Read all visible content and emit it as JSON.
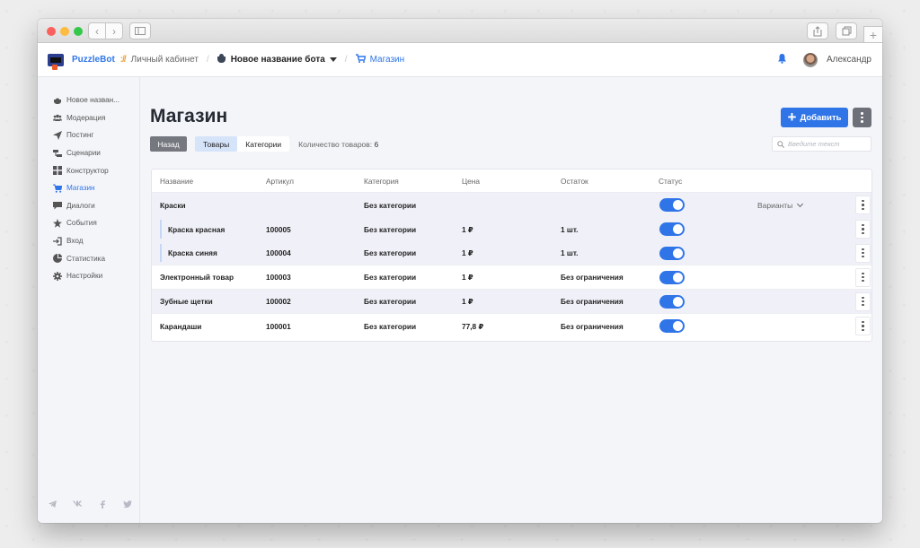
{
  "browser": {
    "icons": [
      "back-icon",
      "forward-icon",
      "sidebar-icon",
      "share-icon",
      "tabs-icon",
      "new-tab-icon"
    ]
  },
  "header": {
    "brand": "PuzzleBot",
    "brand_sep": "://",
    "crumb_cabinet": "Личный кабинет",
    "bot_name": "Новое название бота",
    "crumb_shop": "Магазин",
    "user_name": "Александр",
    "accent": "#2f75e8"
  },
  "sidebar": {
    "items": [
      {
        "label": "Новое назван...",
        "icon": "bot-icon",
        "active": false
      },
      {
        "label": "Модерация",
        "icon": "users-icon",
        "active": false
      },
      {
        "label": "Постинг",
        "icon": "send-icon",
        "active": false
      },
      {
        "label": "Сценарии",
        "icon": "scenario-icon",
        "active": false
      },
      {
        "label": "Конструктор",
        "icon": "grid-icon",
        "active": false
      },
      {
        "label": "Магазин",
        "icon": "cart-icon",
        "active": true
      },
      {
        "label": "Диалоги",
        "icon": "chat-icon",
        "active": false
      },
      {
        "label": "События",
        "icon": "star-icon",
        "active": false
      },
      {
        "label": "Вход",
        "icon": "login-icon",
        "active": false
      },
      {
        "label": "Статистика",
        "icon": "chart-icon",
        "active": false
      },
      {
        "label": "Настройки",
        "icon": "gear-icon",
        "active": false
      }
    ],
    "social": [
      "telegram-icon",
      "vk-icon",
      "facebook-icon",
      "twitter-icon"
    ]
  },
  "main": {
    "title": "Магазин",
    "add_label": "Добавить",
    "back_label": "Назад",
    "tab_products": "Товары",
    "tab_categories": "Категории",
    "count_label": "Количество товаров:",
    "count_value": "6",
    "search_placeholder": "Введите текст"
  },
  "table": {
    "headers": {
      "name": "Название",
      "sku": "Артикул",
      "category": "Категория",
      "price": "Цена",
      "stock": "Остаток",
      "status": "Статус"
    },
    "variants_label": "Варианты",
    "rows": [
      {
        "name": "Краски",
        "sku": "",
        "category": "Без категории",
        "price": "",
        "stock": "",
        "status": true
      },
      {
        "name": "Краска красная",
        "sku": "100005",
        "category": "Без категории",
        "price": "1 ₽",
        "stock": "1 шт.",
        "status": true
      },
      {
        "name": "Краска синяя",
        "sku": "100004",
        "category": "Без категории",
        "price": "1 ₽",
        "stock": "1 шт.",
        "status": true
      },
      {
        "name": "Электронный товар",
        "sku": "100003",
        "category": "Без категории",
        "price": "1 ₽",
        "stock": "Без ограничения",
        "status": true
      },
      {
        "name": "Зубные щетки",
        "sku": "100002",
        "category": "Без категории",
        "price": "1 ₽",
        "stock": "Без ограничения",
        "status": true
      },
      {
        "name": "Карандаши",
        "sku": "100001",
        "category": "Без категории",
        "price": "77,8 ₽",
        "stock": "Без ограничения",
        "status": true
      }
    ]
  }
}
